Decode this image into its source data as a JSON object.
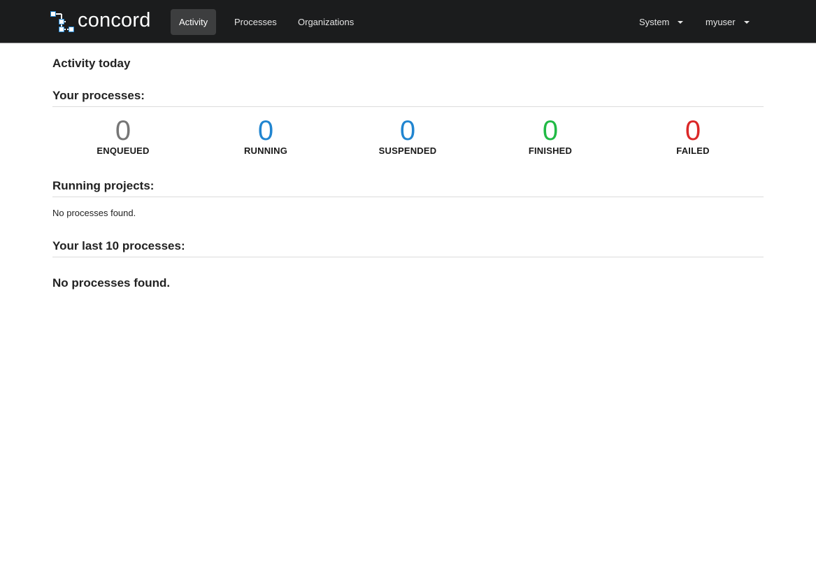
{
  "app": {
    "name": "concord"
  },
  "nav": {
    "items": [
      {
        "label": "Activity",
        "active": true
      },
      {
        "label": "Processes",
        "active": false
      },
      {
        "label": "Organizations",
        "active": false
      }
    ],
    "system_label": "System",
    "user_label": "myuser"
  },
  "page": {
    "title": "Activity today"
  },
  "your_processes": {
    "header": "Your processes:",
    "stats": [
      {
        "value": "0",
        "label": "ENQUEUED",
        "color": "#767676"
      },
      {
        "value": "0",
        "label": "RUNNING",
        "color": "#2185d0"
      },
      {
        "value": "0",
        "label": "SUSPENDED",
        "color": "#2185d0"
      },
      {
        "value": "0",
        "label": "FINISHED",
        "color": "#21ba45"
      },
      {
        "value": "0",
        "label": "FAILED",
        "color": "#db2828"
      }
    ]
  },
  "running_projects": {
    "header": "Running projects:",
    "empty_text": "No processes found."
  },
  "last_processes": {
    "header": "Your last 10 processes:",
    "empty_text": "No processes found."
  }
}
